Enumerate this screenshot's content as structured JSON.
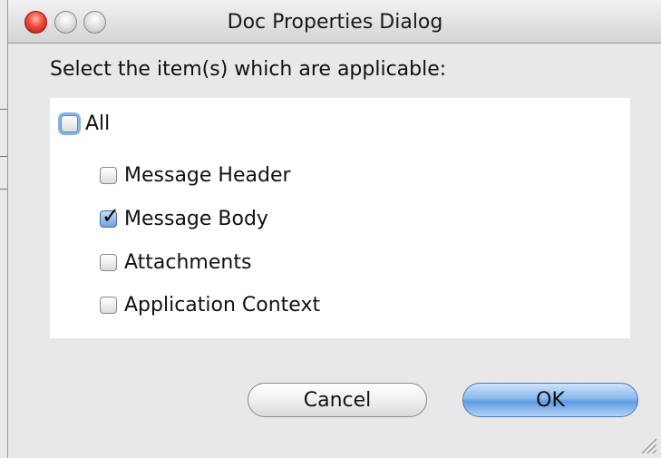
{
  "window": {
    "title": "Doc Properties Dialog"
  },
  "prompt": "Select the item(s) which are applicable:",
  "options": {
    "all": {
      "label": "All",
      "checked": false
    },
    "items": [
      {
        "label": "Message Header",
        "checked": false
      },
      {
        "label": "Message Body",
        "checked": true
      },
      {
        "label": "Attachments",
        "checked": false
      },
      {
        "label": "Application Context",
        "checked": false
      }
    ]
  },
  "buttons": {
    "cancel": "Cancel",
    "ok": "OK"
  },
  "icons": {
    "close": "close-icon",
    "minimize": "minimize-icon",
    "zoom": "zoom-icon",
    "check": "checkmark-icon",
    "resize": "resize-grip-icon"
  },
  "colors": {
    "close_red": "#f04a3c",
    "default_button_blue": "#5e9be2",
    "checked_blue": "#6fa2e0"
  }
}
